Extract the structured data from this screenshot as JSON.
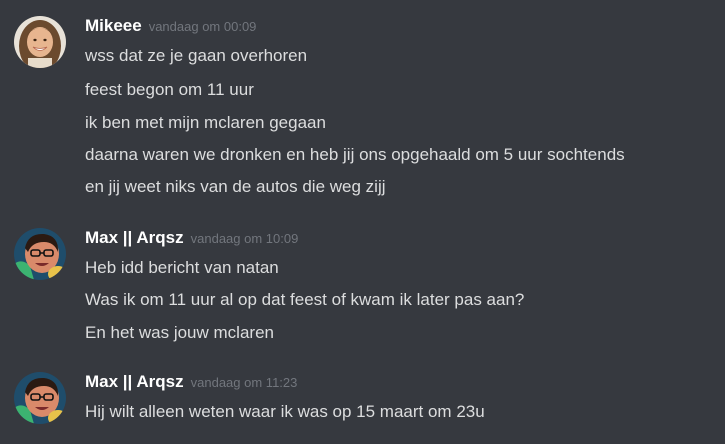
{
  "messages": [
    {
      "author": "Mikeee",
      "timestamp": "vandaag om 00:09",
      "avatar": "girl-avatar",
      "lines": [
        "wss dat ze je gaan overhoren",
        "feest begon om 11 uur",
        "ik ben met mijn mclaren gegaan",
        "daarna waren we dronken en heb jij ons opgehaald om 5 uur sochtends",
        "en jij weet niks van de autos die weg zijj"
      ]
    },
    {
      "author": "Max || Arqsz",
      "timestamp": "vandaag om 10:09",
      "avatar": "cartoon-avatar",
      "lines": [
        "Heb idd bericht van natan",
        "Was ik om 11 uur al op dat feest of kwam ik later pas aan?",
        "En het was jouw mclaren"
      ]
    },
    {
      "author": "Max || Arqsz",
      "timestamp": "vandaag om 11:23",
      "avatar": "cartoon-avatar",
      "lines": [
        "Hij wilt alleen weten waar ik was op 15 maart om 23u"
      ]
    }
  ],
  "colors": {
    "background": "#36393f",
    "username": "#ffffff",
    "text": "#dcddde",
    "timestamp": "#72767d"
  }
}
